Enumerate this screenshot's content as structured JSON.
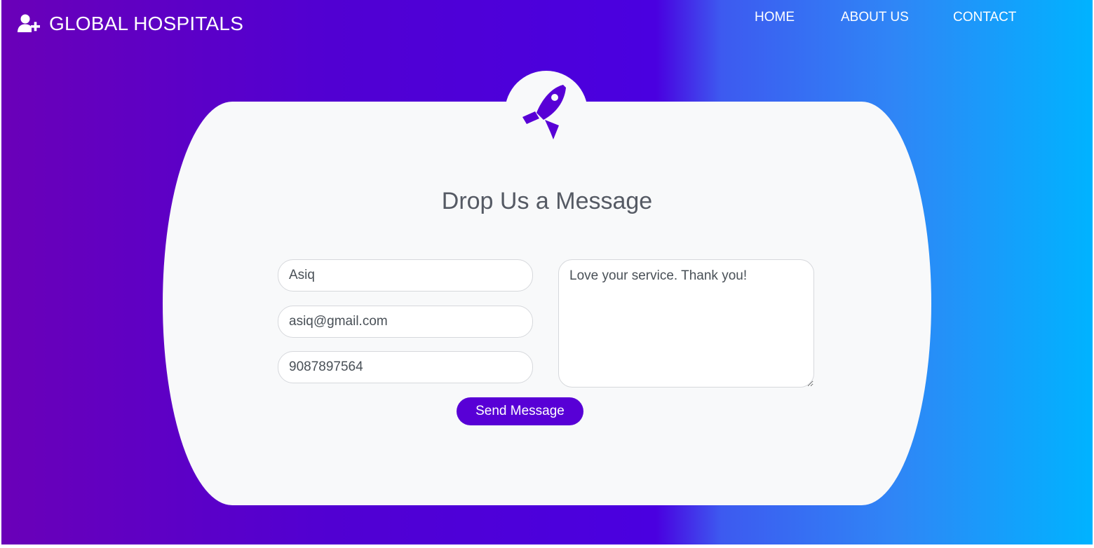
{
  "header": {
    "brand": {
      "icon": "user-plus-icon",
      "name": "GLOBAL HOSPITALS"
    },
    "nav": [
      {
        "label": "HOME"
      },
      {
        "label": "ABOUT US"
      },
      {
        "label": "CONTACT"
      }
    ]
  },
  "colors": {
    "gradient": [
      "#6a00b8",
      "#4a00e0",
      "#00b3ff"
    ],
    "accent": "#5800d6",
    "card_bg": "#f8f9fa"
  },
  "contact_form": {
    "badge_icon": "rocket-icon",
    "title": "Drop Us a Message",
    "name_value": "Asiq",
    "email_value": "asiq@gmail.com",
    "phone_value": "9087897564",
    "message_value": "Love your service. Thank you!",
    "submit_label": "Send Message"
  }
}
